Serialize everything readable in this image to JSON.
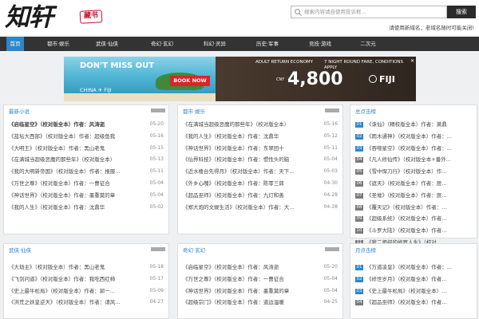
{
  "logo": {
    "main": "知轩",
    "seal": "藏书"
  },
  "search": {
    "placeholder": "搜索内容请自使用投诉框...",
    "button": "搜索"
  },
  "notice": "请使用新域名，老域名随时可能关闭!",
  "nav": {
    "items": [
      "首页",
      "都市·娱乐",
      "武侠·仙侠",
      "奇幻·玄幻",
      "科幻·灵异",
      "历史·军事",
      "竞技·游戏",
      "二次元"
    ],
    "active": 0
  },
  "ad": {
    "dont_miss": "DON'T MISS OUT",
    "china": "CHINA ✈ FIJI",
    "book_now": "BOOK NOW",
    "adult_economy": "ADULT RETURN ECONOMY",
    "seven_nights": "7 NIGHT ROUND FARE, CONDITIONS APPLY",
    "cny": "CNY",
    "price": "4,800",
    "fiji": "FIJI",
    "brand_color": "#d9262a",
    "accent_color": "#2e86c9"
  },
  "panels": {
    "newest": {
      "title": "最新小说",
      "items": [
        {
          "text": "《启临星空》（校对版全本）作者：风涛逝",
          "date": "05-20",
          "bold": true
        },
        {
          "text": "《蓝坛大西部》（校对版全本）作者：超级鱼我",
          "date": "05-16"
        },
        {
          "text": "《大明王》（校对版全本）作者：黑山老鬼",
          "date": "05-15"
        },
        {
          "text": "《在满城当超级恶魔的那些年》（校对版全本）",
          "date": "05-13"
        },
        {
          "text": "《我的大明新帝国》（校对版全本）作者：报服...",
          "date": "05-11"
        },
        {
          "text": "《万世之尊》（校对版全本）作者：一曹征合",
          "date": "05-04"
        },
        {
          "text": "《神话世界》（校对版全本）作者：墨重莫的章",
          "date": "05-04"
        },
        {
          "text": "《我的人生》（校对版全本）作者：沈鼎华",
          "date": "05-02"
        }
      ]
    },
    "urban": {
      "title": "都市·娱乐",
      "items": [
        {
          "text": "《在满城当超级恶魔的那些年》（校对版全本）",
          "date": "05-16"
        },
        {
          "text": "《我的人生》（校对版全本）作者：沈鼎华",
          "date": "05-12"
        },
        {
          "text": "《神话世界》（校对版全本）作者：东翠田十",
          "date": "05-11"
        },
        {
          "text": "《仙界科技》（校对版全本）作者：惯性头的脑",
          "date": "05-04"
        },
        {
          "text": "《近水楼台先得月》（校对版全本）作者：天下...",
          "date": "05-03"
        },
        {
          "text": "《外乡心魄》（校对版全本）作者：陈零三郎",
          "date": "04-30"
        },
        {
          "text": "《超品巫师》（校对版全本）作者：九灯和善",
          "date": "04-28"
        },
        {
          "text": "《郑大炮的文娱生活》（校对版全本）作者：大...",
          "date": "04-28"
        }
      ]
    },
    "ranking": {
      "title": "总点击榜",
      "items": [
        {
          "num": "01",
          "text": "《诛仙》（精校版全本）作者：萧鼎"
        },
        {
          "num": "02",
          "text": "《雨木通神》（校对版全本）作者：..."
        },
        {
          "num": "03",
          "text": "《吞噬星空》（校对版全本）作者：..."
        },
        {
          "num": "04",
          "text": "《凡人修仙传》（校对版全本+番外..."
        },
        {
          "num": "05",
          "text": "《雪中悍刀行》（校对版全本）作..."
        },
        {
          "num": "06",
          "text": "《遮天》（校对版全本）作者：辰..."
        },
        {
          "num": "07",
          "text": "《圣墟》（校对版全本）作者：辰..."
        },
        {
          "num": "08",
          "text": "《覆天记》（校对版全本）作者：..."
        },
        {
          "num": "09",
          "text": "《超级系统》（校对版全本）作者..."
        },
        {
          "num": "10",
          "text": "《斗罗大陆》（校对版全本）作者..."
        },
        {
          "num": "11",
          "text": "《我二师叔的修罗人生》（校对..."
        }
      ]
    },
    "wuxia": {
      "title": "武侠·仙侠",
      "items": [
        {
          "text": "《大劫主》（校对版全本）作者：黑山老鬼",
          "date": "05-18"
        },
        {
          "text": "《飞剑问道》（校对版全本）作者：我吃西红柿",
          "date": "05-17"
        },
        {
          "text": "《史上最牛松局》（校对版全本）作者：郭一...",
          "date": "05-09"
        },
        {
          "text": "《洪荒之妖皇逆天》（校对版全本）作者：请风...",
          "date": "04-27"
        }
      ]
    },
    "fantasy": {
      "title": "奇幻·玄幻",
      "items": [
        {
          "text": "《启临星空》（校对版全本）作者：风涛逝",
          "date": "05-20"
        },
        {
          "text": "《万世之尊》（校对版全本）作者：一曹征合",
          "date": "05-04"
        },
        {
          "text": "《神话世界》（校对版全本）作者：墨重莫的章",
          "date": "05-04"
        },
        {
          "text": "《超级宗门》（校对版全本）作者：道边温暖",
          "date": "04-25"
        }
      ]
    },
    "monthly": {
      "title": "月点击榜",
      "items": [
        {
          "num": "01",
          "text": "《万道凌皇》（校对版全本）作者：..."
        },
        {
          "num": "02",
          "text": "《修世岁月》（校对版全本）作者..."
        },
        {
          "num": "03",
          "text": "《史上最牛松局》（校对版全本）..."
        },
        {
          "num": "04",
          "text": "《超品巫师》（校对版全本）作者..."
        }
      ]
    }
  }
}
